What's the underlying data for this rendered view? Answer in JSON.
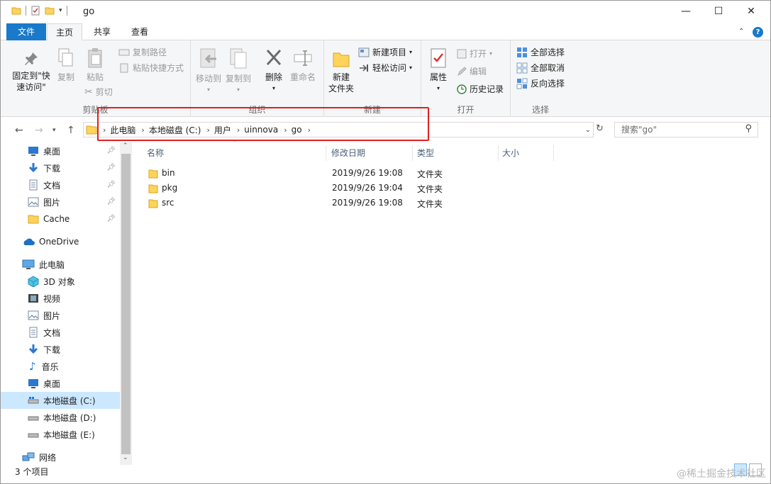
{
  "window": {
    "title": "go",
    "minimize_glyph": "—",
    "maximize_glyph": "☐",
    "close_glyph": "✕"
  },
  "tabs": {
    "file": "文件",
    "home": "主页",
    "share": "共享",
    "view": "查看"
  },
  "ribbon": {
    "clipboard": {
      "label": "剪贴板",
      "pin_line1": "固定到\"快",
      "pin_line2": "速访问\"",
      "copy": "复制",
      "paste": "粘贴",
      "copy_path": "复制路径",
      "paste_shortcut": "粘贴快捷方式",
      "cut": "剪切"
    },
    "organize": {
      "label": "组织",
      "move_to": "移动到",
      "copy_to": "复制到",
      "delete": "删除",
      "rename": "重命名"
    },
    "new": {
      "label": "新建",
      "new_folder_line1": "新建",
      "new_folder_line2": "文件夹",
      "new_item": "新建项目",
      "easy_access": "轻松访问"
    },
    "open": {
      "label": "打开",
      "properties": "属性",
      "open": "打开",
      "edit": "编辑",
      "history": "历史记录"
    },
    "select": {
      "label": "选择",
      "select_all": "全部选择",
      "select_none": "全部取消",
      "invert": "反向选择"
    }
  },
  "address": {
    "crumbs": [
      "此电脑",
      "本地磁盘 (C:)",
      "用户",
      "uinnova",
      "go"
    ],
    "search_placeholder": "搜索\"go\""
  },
  "sidebar": {
    "items": [
      {
        "label": "桌面",
        "icon": "desktop-icon",
        "pinned": true
      },
      {
        "label": "下载",
        "icon": "download-icon",
        "pinned": true
      },
      {
        "label": "文档",
        "icon": "document-icon",
        "pinned": true
      },
      {
        "label": "图片",
        "icon": "picture-icon",
        "pinned": true
      },
      {
        "label": "Cache",
        "icon": "folder-icon",
        "pinned": true
      },
      {
        "label": "OneDrive",
        "icon": "cloud-icon"
      },
      {
        "label": "此电脑",
        "icon": "computer-icon"
      },
      {
        "label": "3D 对象",
        "icon": "cube-icon"
      },
      {
        "label": "视频",
        "icon": "video-icon"
      },
      {
        "label": "图片",
        "icon": "picture-icon"
      },
      {
        "label": "文档",
        "icon": "document-icon"
      },
      {
        "label": "下载",
        "icon": "download-icon"
      },
      {
        "label": "音乐",
        "icon": "music-icon"
      },
      {
        "label": "桌面",
        "icon": "desktop-icon"
      },
      {
        "label": "本地磁盘 (C:)",
        "icon": "drive-icon",
        "selected": true
      },
      {
        "label": "本地磁盘 (D:)",
        "icon": "drive-icon"
      },
      {
        "label": "本地磁盘 (E:)",
        "icon": "drive-icon"
      },
      {
        "label": "网络",
        "icon": "network-icon"
      }
    ]
  },
  "columns": {
    "name": "名称",
    "modified": "修改日期",
    "type": "类型",
    "size": "大小"
  },
  "files": [
    {
      "name": "bin",
      "modified": "2019/9/26 19:08",
      "type": "文件夹"
    },
    {
      "name": "pkg",
      "modified": "2019/9/26 19:04",
      "type": "文件夹"
    },
    {
      "name": "src",
      "modified": "2019/9/26 19:08",
      "type": "文件夹"
    }
  ],
  "status": {
    "item_count": "3 个项目"
  },
  "watermark": "@稀土掘金技术社区",
  "colors": {
    "accent": "#1979ca",
    "highlight_box": "#e02020",
    "folder": "#ffd35c",
    "selection": "#cce8ff"
  }
}
